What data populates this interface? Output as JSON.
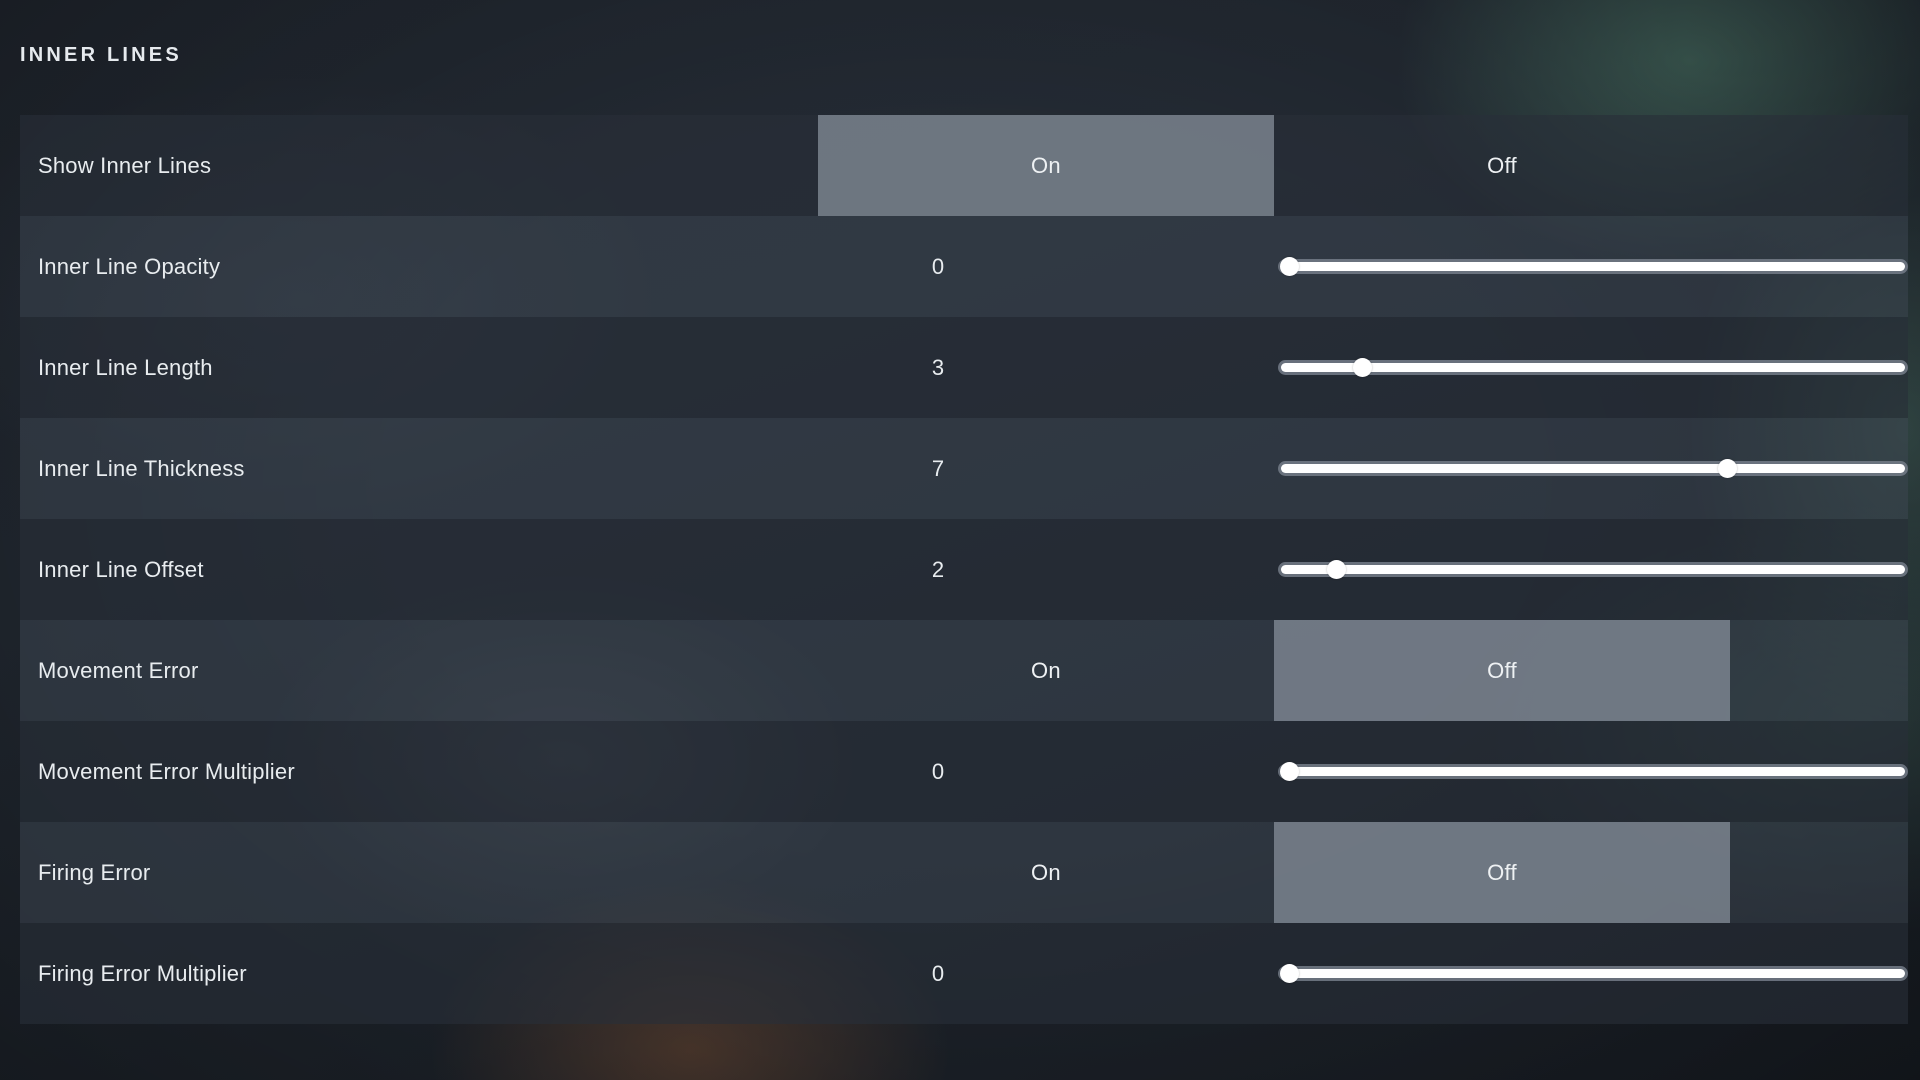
{
  "section": {
    "title": "INNER LINES"
  },
  "toggle": {
    "on_label": "On",
    "off_label": "Off"
  },
  "slider": {
    "min": 0,
    "max": 10
  },
  "colors": {
    "selected_toggle": "#808894",
    "row_odd": "#282f39",
    "row_even": "#3e4652",
    "text": "#e8ecef",
    "slider_fill": "#ffffff",
    "slider_track": "#747c88"
  },
  "rows": [
    {
      "label": "Show Inner Lines",
      "type": "toggle",
      "selected": "On",
      "options": [
        "On",
        "Off"
      ]
    },
    {
      "label": "Inner Line Opacity",
      "type": "slider",
      "value": "0",
      "percent": 0.5
    },
    {
      "label": "Inner Line Length",
      "type": "slider",
      "value": "3",
      "percent": 12
    },
    {
      "label": "Inner Line Thickness",
      "type": "slider",
      "value": "7",
      "percent": 70
    },
    {
      "label": "Inner Line Offset",
      "type": "slider",
      "value": "2",
      "percent": 8
    },
    {
      "label": "Movement Error",
      "type": "toggle",
      "selected": "Off",
      "options": [
        "On",
        "Off"
      ]
    },
    {
      "label": "Movement Error Multiplier",
      "type": "slider",
      "value": "0",
      "percent": 0.5
    },
    {
      "label": "Firing Error",
      "type": "toggle",
      "selected": "Off",
      "options": [
        "On",
        "Off"
      ]
    },
    {
      "label": "Firing Error Multiplier",
      "type": "slider",
      "value": "0",
      "percent": 0.5
    }
  ]
}
